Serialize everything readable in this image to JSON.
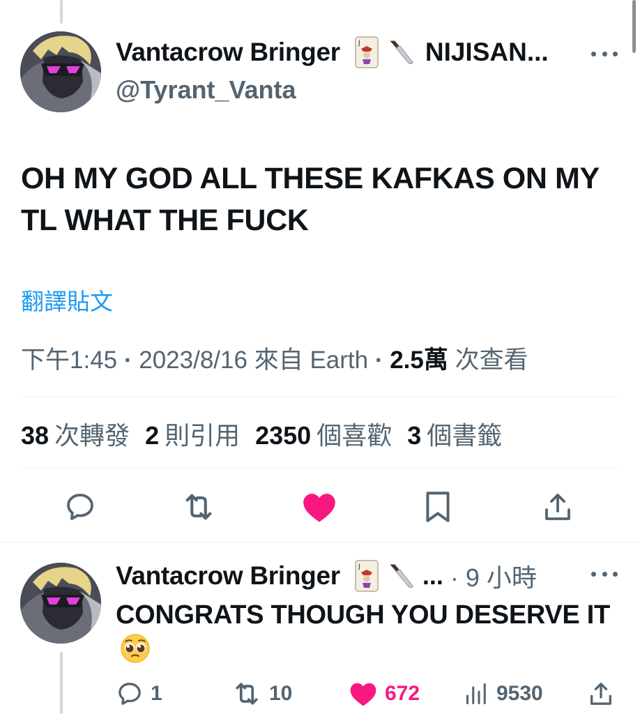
{
  "colors": {
    "accent": "#1d9bf0",
    "like_pink": "#f91880",
    "muted_text": "#536471",
    "main_text": "#0f1419"
  },
  "main_tweet": {
    "display_name": "Vantacrow Bringer",
    "name_emojis": [
      "joker-card-emoji",
      "knife-emoji"
    ],
    "name_extra": "NIJISAN...",
    "handle": "@Tyrant_Vanta",
    "text": "OH MY GOD ALL THESE KAFKAS ON MY TL WHAT THE FUCK",
    "translate_label": "翻譯貼文",
    "meta": {
      "time": "下午1:45",
      "separator": " · ",
      "date": "2023/8/16",
      "source_prefix": "來自",
      "source": "Earth",
      "views_count": "2.5萬",
      "views_label": "次查看"
    },
    "stats": [
      {
        "count": "38",
        "label": "次轉發"
      },
      {
        "count": "2",
        "label": "則引用"
      },
      {
        "count": "2350",
        "label": "個喜歡"
      },
      {
        "count": "3",
        "label": "個書籤"
      }
    ],
    "actions": [
      "reply-icon",
      "retweet-icon",
      "like-icon-filled",
      "bookmark-icon",
      "share-icon"
    ]
  },
  "reply_tweet": {
    "display_name": "Vantacrow Bringer",
    "name_emojis": [
      "joker-card-emoji",
      "knife-emoji"
    ],
    "ellipsis": "...",
    "time": "· 9 小時",
    "text": "CONGRATS THOUGH YOU DESERVE IT",
    "text_emoji": "pleading-face-emoji",
    "actions": {
      "replies": "1",
      "retweets": "10",
      "likes": "672",
      "views": "9530"
    }
  }
}
